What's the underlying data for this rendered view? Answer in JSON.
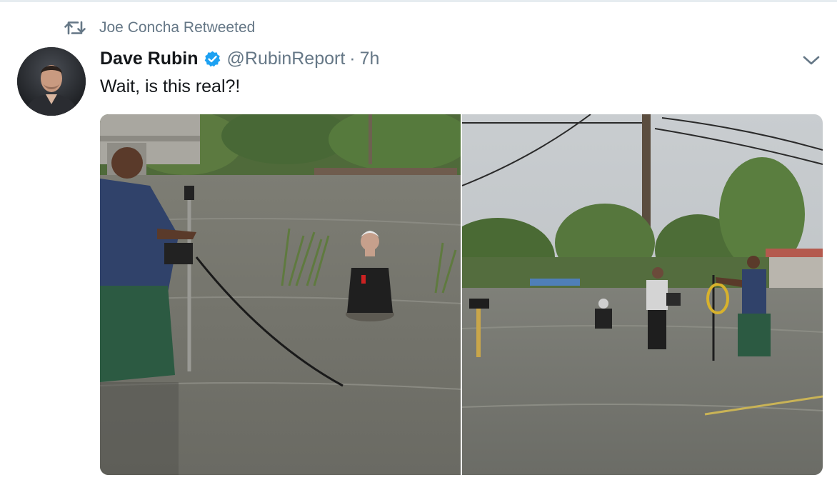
{
  "retweet": {
    "icon": "retweet-icon",
    "text": "Joe Concha Retweeted"
  },
  "tweet": {
    "author_name": "Dave Rubin",
    "verified_icon": "verified-badge-icon",
    "handle": "@RubinReport",
    "separator": "·",
    "time": "7h",
    "text": "Wait, is this real?!",
    "menu_icon": "chevron-down-icon"
  },
  "media": {
    "photos": [
      {
        "description_icon": "flood-reporter-photo",
        "name": "photo-1"
      },
      {
        "description_icon": "flood-crew-photo",
        "name": "photo-2"
      }
    ]
  },
  "colors": {
    "text": "#14171a",
    "secondary": "#657786",
    "accent": "#1da1f2",
    "divider": "#e6ecf0"
  }
}
